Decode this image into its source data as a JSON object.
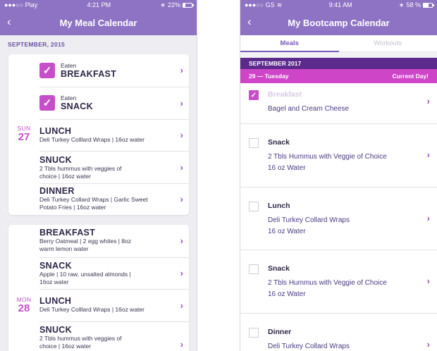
{
  "left_phone": {
    "status": {
      "carrier": "●●●○○ Play",
      "time": "4:21 PM",
      "battery": "22%",
      "battery_level": 0.22
    },
    "title": "My Meal Calendar",
    "back_glyph": "‹",
    "month": "SEPTEMBER, 2015",
    "day1": {
      "dow": "SUN",
      "day": "27",
      "meals": [
        {
          "eaten": true,
          "eaten_label": "Eaten",
          "name": "BREAKFAST"
        },
        {
          "eaten": true,
          "eaten_label": "Eaten",
          "name": "SNACK"
        },
        {
          "name": "LUNCH",
          "desc": "Deli Turkey Colllard Wraps  | 16oz water"
        },
        {
          "name": "SNUCK",
          "desc": "2 Tbls hummus with veggies of choice | 16oz water"
        },
        {
          "name": "DINNER",
          "desc": "Deli Turkey Collard Wraps | Garlic Sweet Potato Fries | 16oz water"
        }
      ]
    },
    "day2": {
      "dow": "MON",
      "day": "28",
      "meals": [
        {
          "name": "BREAKFAST",
          "desc": "Berry Oatmeal  |  2 egg whites  |  8oz warm lemon water"
        },
        {
          "name": "SNACK",
          "desc": "Apple  |  10 raw, unsalted almonds  |  16oz water"
        },
        {
          "name": "LUNCH",
          "desc": "Deli Turkey Colllard Wraps  |  16oz water"
        },
        {
          "name": "SNUCK",
          "desc": "2 Tbls hummus with veggies of choice  |  16oz water"
        }
      ]
    },
    "chevron": "›",
    "checkmark": "✓"
  },
  "right_phone": {
    "status": {
      "carrier": "●●●○○ GS",
      "time": "9:41 AM",
      "battery": "58 %",
      "battery_level": 0.58
    },
    "title": "My Bootcamp Calendar",
    "back_glyph": "‹",
    "tabs": [
      "Meals",
      "Workouts"
    ],
    "month": "SEPTEMBER 2017",
    "today": {
      "date": "29 — Tuesday",
      "label": "Current Day!"
    },
    "meals": [
      {
        "checked": true,
        "name": "Breakfast",
        "lines": [
          "Bagel and Cream Cheese"
        ]
      },
      {
        "checked": false,
        "name": "Snack",
        "lines": [
          "2 Tbls Hummus with Veggie of Choice",
          "16 oz Water"
        ]
      },
      {
        "checked": false,
        "name": "Lunch",
        "lines": [
          "Deli Turkey Collard Wraps",
          "16 oz Water"
        ]
      },
      {
        "checked": false,
        "name": "Snack",
        "lines": [
          "2 Tbls Hummus with Veggie of Choice",
          "16 oz Water"
        ]
      },
      {
        "checked": false,
        "name": "Dinner",
        "lines": [
          "Deli Turkey Collard Wraps"
        ]
      }
    ],
    "chevron": "›",
    "checkmark": "✓"
  },
  "colors": {
    "header": "#8e72c4",
    "accent": "#c64fc9",
    "month_bar": "#5b2a8c",
    "today_bar": "#cf45c8"
  }
}
